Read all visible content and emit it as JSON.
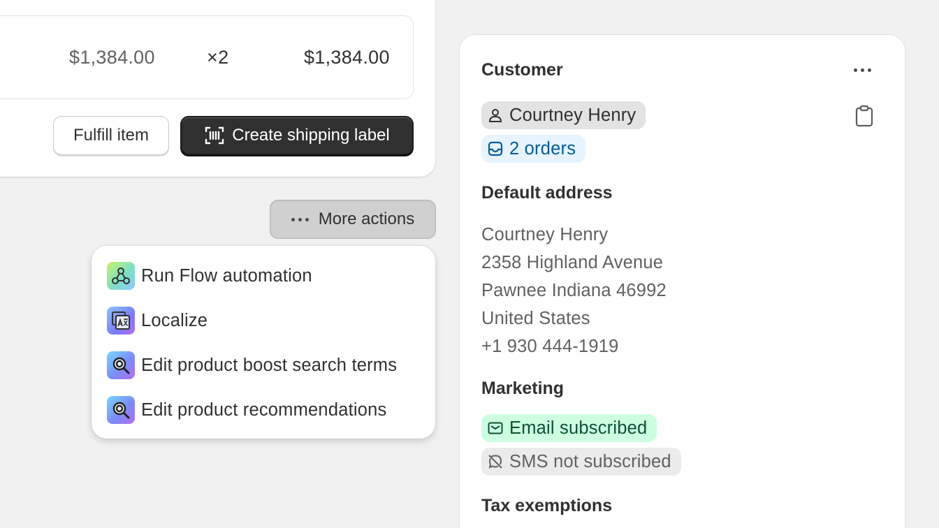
{
  "line_item": {
    "price": "$1,384.00",
    "quantity": "×2",
    "total": "$1,384.00"
  },
  "fulfillment_actions": {
    "fulfill_label": "Fulfill item",
    "shipping_label": "Create shipping label",
    "shipping_icon": "barcode-scan-icon"
  },
  "more_actions": {
    "label": "More actions",
    "items": [
      {
        "label": "Run Flow automation",
        "icon": "flow-app-icon"
      },
      {
        "label": "Localize",
        "icon": "translate-app-icon"
      },
      {
        "label": "Edit product boost search terms",
        "icon": "search-app-icon"
      },
      {
        "label": "Edit product recommendations",
        "icon": "search-app-icon"
      }
    ]
  },
  "customer": {
    "title": "Customer",
    "name": "Courtney Henry",
    "orders": "2 orders",
    "default_address_heading": "Default address",
    "address_lines": [
      "Courtney Henry",
      "2358 Highland Avenue",
      "Pawnee Indiana 46992",
      "United States",
      "+1 930 444-1919"
    ],
    "marketing_heading": "Marketing",
    "email_status": "Email subscribed",
    "sms_status": "SMS not subscribed",
    "tax_heading": "Tax exemptions"
  },
  "colors": {
    "primary_button": "#303030",
    "email_badge_bg": "#cdfee1",
    "orders_badge_bg": "#e8f4fd",
    "orders_text": "#005b9a"
  }
}
